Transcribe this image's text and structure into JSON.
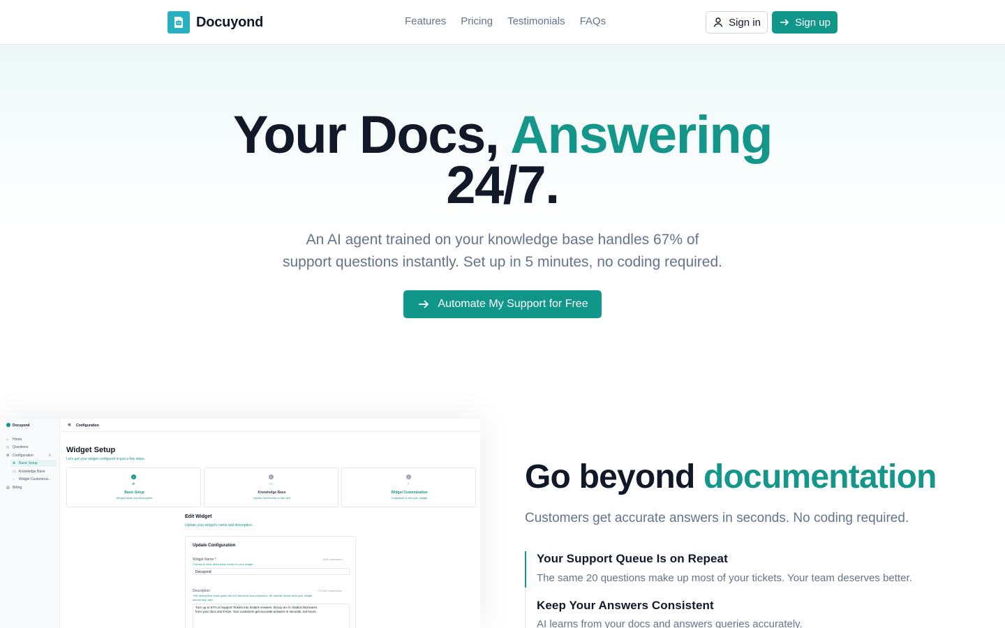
{
  "nav": {
    "brand": "Docuyond",
    "links": [
      "Features",
      "Pricing",
      "Testimonials",
      "FAQs"
    ],
    "signin_label": "Sign in",
    "signup_label": "Sign up"
  },
  "hero": {
    "title_part1": "Your Docs, ",
    "title_accent": "Answering",
    "title_part2": "24/7.",
    "subtitle_line1": "An AI agent trained on your knowledge base handles 67% of",
    "subtitle_line2": "support questions instantly. Set up in 5 minutes, no coding required.",
    "cta_label": "Automate My Support for Free"
  },
  "mockup": {
    "workspace": "Docuyond",
    "nav": [
      "Home",
      "Questions",
      "Configuration",
      "Basic Setup",
      "Knowledge Base",
      "Widget Customizat...",
      "Billing"
    ],
    "breadcrumb": "Configuration",
    "title": "Widget Setup",
    "subtitle": "Let's get your widget configured in just a few steps.",
    "steps": [
      {
        "num": "1",
        "title": "Basic Setup",
        "desc": "Widget name and description"
      },
      {
        "num": "2",
        "title": "Knowledge Base",
        "desc": "Upload documents or add text"
      },
      {
        "num": "3",
        "title": "Widget Customization",
        "desc": "Customize & test your widget"
      }
    ],
    "edit_title": "Edit Widget",
    "edit_sub": "Update your widget's name and description.",
    "form_title": "Update Configuration",
    "name_label": "Widget Name *",
    "name_count": "8/50 characters",
    "name_hint": "Choose a clear, descriptive name for your widget",
    "name_value": "Docuyond",
    "desc_label": "Description",
    "desc_count": "172/500 characters",
    "desc_hint_1": "This description helps guide the AI's behavior and responses. Be specific about what your widget",
    "desc_hint_2": "should help with.",
    "desc_value_1": "Turn up to 67% of Support Tickets into Instant Answers. Docuy an AI chatbot that learns",
    "desc_value_2": "from your docs and FAQs. Your customers get accurate answers in seconds, not hours."
  },
  "features": {
    "title_part1": "Go beyond ",
    "title_accent": "documentation",
    "subtitle": "Customers get accurate answers in seconds. No coding required.",
    "items": [
      {
        "title": "Your Support Queue Is on Repeat",
        "desc": "The same 20 questions make up most of your tickets. Your team deserves better."
      },
      {
        "title": "Keep Your Answers Consistent",
        "desc": "AI learns from your docs and answers queries accurately."
      }
    ]
  },
  "colors": {
    "accent": "#14968b",
    "button": "#11968a",
    "logo_bg": "#2ab0c0",
    "text_dark": "#111827",
    "text_muted": "#64748b"
  }
}
